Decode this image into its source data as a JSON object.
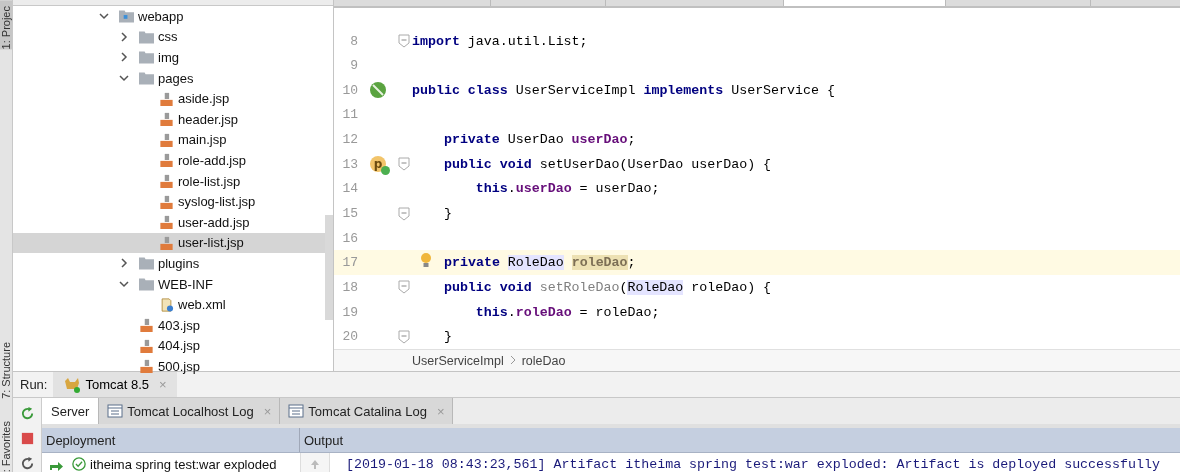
{
  "tool_strip": [
    {
      "label": "1: Projec",
      "kind": "project"
    },
    {
      "label": "7: Structure",
      "kind": "structure"
    },
    {
      "label": ": Favorites",
      "kind": "favorites"
    }
  ],
  "editor_tabs": [
    {
      "selected": false
    },
    {
      "selected": false
    },
    {
      "selected": false
    },
    {
      "selected": true
    },
    {
      "selected": false
    },
    {
      "selected": false
    }
  ],
  "project_tree": [
    {
      "name": "webapp",
      "kind": "webroot",
      "expanded": true,
      "selected": false,
      "children": [
        {
          "name": "css",
          "kind": "folder",
          "expanded": false,
          "selected": false
        },
        {
          "name": "img",
          "kind": "folder",
          "expanded": false,
          "selected": false
        },
        {
          "name": "pages",
          "kind": "folder",
          "expanded": true,
          "selected": false,
          "children": [
            {
              "name": "aside.jsp",
              "kind": "jsp",
              "selected": false
            },
            {
              "name": "header.jsp",
              "kind": "jsp",
              "selected": false
            },
            {
              "name": "main.jsp",
              "kind": "jsp",
              "selected": false
            },
            {
              "name": "role-add.jsp",
              "kind": "jsp",
              "selected": false
            },
            {
              "name": "role-list.jsp",
              "kind": "jsp",
              "selected": false
            },
            {
              "name": "syslog-list.jsp",
              "kind": "jsp",
              "selected": false
            },
            {
              "name": "user-add.jsp",
              "kind": "jsp",
              "selected": false
            },
            {
              "name": "user-list.jsp",
              "kind": "jsp",
              "selected": true
            }
          ]
        },
        {
          "name": "plugins",
          "kind": "folder",
          "expanded": false,
          "selected": false
        },
        {
          "name": "WEB-INF",
          "kind": "folder",
          "expanded": true,
          "selected": false,
          "children": [
            {
              "name": "web.xml",
              "kind": "xml",
              "selected": false
            }
          ]
        },
        {
          "name": "403.jsp",
          "kind": "jsp",
          "selected": false
        },
        {
          "name": "404.jsp",
          "kind": "jsp",
          "selected": false
        },
        {
          "name": "500.jsp",
          "kind": "jsp",
          "selected": false
        }
      ]
    }
  ],
  "code_lines": [
    {
      "number": "8",
      "fold": true,
      "current": false,
      "tokens": [
        {
          "text": "import",
          "kind": "kw"
        },
        {
          "text": " java.util.List;",
          "kind": "plain"
        }
      ]
    },
    {
      "number": "9",
      "fold": false,
      "current": false
    },
    {
      "number": "10",
      "fold": false,
      "current": false,
      "gutter": {
        "kind": "bean"
      },
      "tokens": [
        {
          "text": "public class",
          "kind": "kw"
        },
        {
          "text": " UserServiceImpl ",
          "kind": "plain"
        },
        {
          "text": "implements",
          "kind": "kw"
        },
        {
          "text": " UserService {",
          "kind": "plain"
        }
      ]
    },
    {
      "number": "11",
      "fold": false,
      "current": false
    },
    {
      "number": "12",
      "fold": false,
      "current": false,
      "tokens": [
        {
          "text": "    private",
          "kind": "kw"
        },
        {
          "text": " UserDao ",
          "kind": "plain"
        },
        {
          "text": "userDao",
          "kind": "field"
        },
        {
          "text": ";",
          "kind": "plain"
        }
      ]
    },
    {
      "number": "13",
      "fold": true,
      "current": false,
      "gutter": {
        "kind": "property",
        "label": "p"
      },
      "tokens": [
        {
          "text": "    public void",
          "kind": "kw"
        },
        {
          "text": " setUserDao(UserDao userDao) {",
          "kind": "plain"
        }
      ]
    },
    {
      "number": "14",
      "fold": false,
      "current": false,
      "tokens": [
        {
          "text": "        this",
          "kind": "kw"
        },
        {
          "text": ".",
          "kind": "plain"
        },
        {
          "text": "userDao",
          "kind": "field"
        },
        {
          "text": " = userDao;",
          "kind": "plain"
        }
      ]
    },
    {
      "number": "15",
      "fold": true,
      "current": false,
      "tokens": [
        {
          "text": "    }",
          "kind": "plain"
        }
      ]
    },
    {
      "number": "16",
      "fold": false,
      "current": false
    },
    {
      "number": "17",
      "fold": false,
      "current": true,
      "intention": true,
      "tokens": [
        {
          "text": "private ",
          "kind": "kw"
        },
        {
          "text": "RoleDao",
          "kind": "usage"
        },
        {
          "text": "roleDao",
          "kind": "unused_field"
        },
        {
          "text": ";",
          "kind": "plain"
        }
      ]
    },
    {
      "number": "18",
      "fold": true,
      "current": false,
      "tokens": [
        {
          "text": "    public void ",
          "kind": "kw"
        },
        {
          "text": "setRoleDao",
          "kind": "unused"
        },
        {
          "text": "(",
          "kind": "plain"
        },
        {
          "text": "RoleDao",
          "kind": "usage"
        },
        {
          "text": " roleDao) {",
          "kind": "plain"
        }
      ]
    },
    {
      "number": "19",
      "fold": false,
      "current": false,
      "tokens": [
        {
          "text": "        this",
          "kind": "kw"
        },
        {
          "text": ".",
          "kind": "plain"
        },
        {
          "text": "roleDao",
          "kind": "field"
        },
        {
          "text": " = roleDao;",
          "kind": "plain"
        }
      ]
    },
    {
      "number": "20",
      "fold": true,
      "current": false,
      "tokens": [
        {
          "text": "    }",
          "kind": "plain"
        }
      ]
    }
  ],
  "breadcrumbs": [
    "UserServiceImpl",
    "roleDao"
  ],
  "run_panel": {
    "label": "Run:",
    "tab": {
      "title": "Tomcat 8.5",
      "close": "×"
    },
    "tabs": [
      {
        "title": "Server",
        "selected": true
      },
      {
        "title": "Tomcat Localhost Log",
        "close": "×",
        "selected": false
      },
      {
        "title": "Tomcat Catalina Log",
        "close": "×",
        "selected": false
      }
    ],
    "columns": [
      "Deployment",
      "Output"
    ],
    "deployment": "itheima spring test:war exploded",
    "output": "[2019-01-18 08:43:23,561] Artifact itheima spring test:war exploded: Artifact is deployed successfully"
  }
}
